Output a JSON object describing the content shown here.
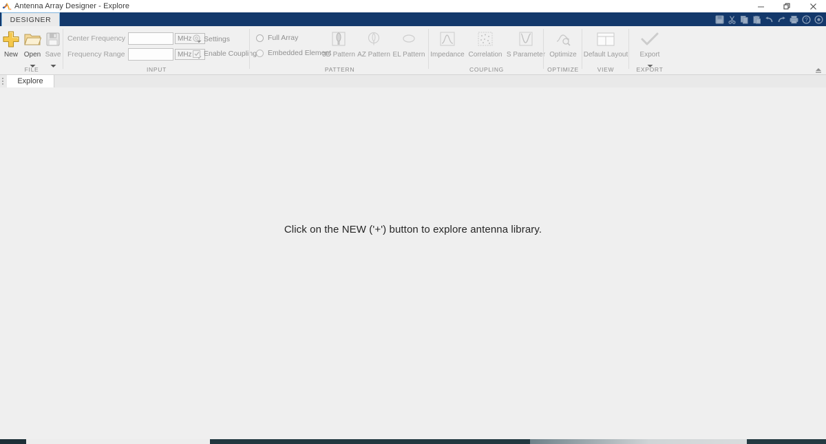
{
  "window": {
    "title": "Antenna Array Designer - Explore",
    "logo_icon": "matlab-membrane-icon",
    "minimize_icon": "minimize-icon",
    "restore_icon": "restore-icon",
    "close_icon": "close-icon"
  },
  "ribbon": {
    "tab": {
      "label": "DESIGNER"
    },
    "collapse_icon": "ribbon-collapse-icon",
    "quick_access": [
      {
        "name": "save-icon",
        "title": "Save"
      },
      {
        "name": "cut-icon",
        "title": "Cut"
      },
      {
        "name": "copy-icon",
        "title": "Copy"
      },
      {
        "name": "paste-icon",
        "title": "Paste"
      },
      {
        "name": "undo-icon",
        "title": "Undo"
      },
      {
        "name": "redo-icon",
        "title": "Redo"
      },
      {
        "name": "print-icon",
        "title": "Print"
      },
      {
        "name": "help-icon",
        "title": "Help"
      },
      {
        "name": "info-icon",
        "title": "Info"
      }
    ],
    "groups": {
      "file": {
        "label": "FILE",
        "buttons": [
          {
            "label": "New",
            "icon": "plus-icon",
            "dropdown": false,
            "enabled": true
          },
          {
            "label": "Open",
            "icon": "folder-icon",
            "dropdown": true,
            "enabled": true
          },
          {
            "label": "Save",
            "icon": "floppy-disk-icon",
            "dropdown": true,
            "enabled": false
          }
        ]
      },
      "input": {
        "label": "INPUT",
        "center_frequency": {
          "label": "Center Frequency",
          "value": "",
          "placeholder": "",
          "unit": "MHz"
        },
        "frequency_range": {
          "label": "Frequency Range",
          "value": "",
          "placeholder": "",
          "unit": "MHz"
        },
        "settings": {
          "label": "Settings",
          "icon": "gear-icon"
        },
        "enable_coupling": {
          "label": "Enable Coupling",
          "checked": true
        }
      },
      "pattern": {
        "label": "PATTERN",
        "options": [
          {
            "label": "Full Array",
            "selected": true
          },
          {
            "label": "Embedded Element",
            "selected": false
          }
        ],
        "buttons": [
          {
            "label": "3D Pattern",
            "icon": "pattern-3d-icon"
          },
          {
            "label": "AZ Pattern",
            "icon": "pattern-az-icon"
          },
          {
            "label": "EL Pattern",
            "icon": "pattern-el-icon"
          }
        ]
      },
      "coupling": {
        "label": "COUPLING",
        "buttons": [
          {
            "label": "Impedance",
            "icon": "impedance-curve-icon"
          },
          {
            "label": "Correlation",
            "icon": "scatter-plot-icon"
          },
          {
            "label": "S Parameter",
            "icon": "s-parameter-icon"
          }
        ]
      },
      "optimize": {
        "label": "OPTIMIZE",
        "buttons": [
          {
            "label": "Optimize",
            "icon": "optimize-icon"
          }
        ]
      },
      "view": {
        "label": "VIEW",
        "buttons": [
          {
            "label": "Default Layout",
            "icon": "layout-grid-icon"
          }
        ]
      },
      "export": {
        "label": "EXPORT",
        "buttons": [
          {
            "label": "Export",
            "icon": "checkmark-icon",
            "dropdown": true
          }
        ]
      }
    }
  },
  "document_tabs": [
    {
      "label": "Explore",
      "active": true
    }
  ],
  "canvas": {
    "message": "Click on the NEW ('+') button to explore antenna library."
  },
  "colors": {
    "ribbon_blue": "#13386b",
    "accent_tab_border": "#7fb3dd",
    "canvas_bg": "#efefef",
    "new_icon_yellow": "#f2c14e"
  }
}
